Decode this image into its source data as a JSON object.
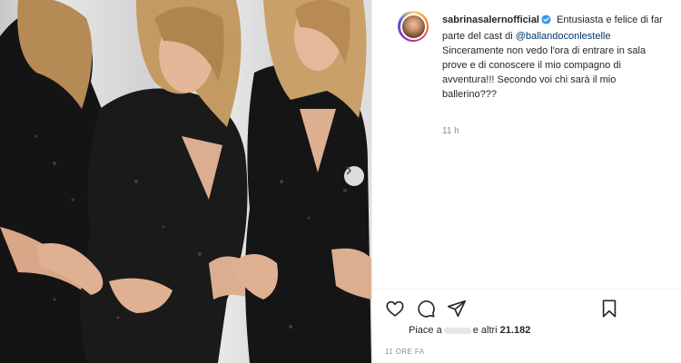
{
  "post": {
    "author": {
      "username": "sabrinasalernofficial",
      "verified": true
    },
    "caption": {
      "text_before_mention": "Entusiasta e felice di far parte del cast di",
      "mention": "@ballandoconlestelle",
      "text_after_mention": "Sinceramente non vedo l'ora di entrare in sala prove e di conoscere il mio compagno di avventura!!! Secondo voi chi sarà il mio ballerino???"
    },
    "comment_time": "11 h",
    "likes": {
      "prefix": "Piace a",
      "middle": "e altri",
      "count": "21.182"
    },
    "timestamp": "11 ORE FA"
  },
  "icons": {
    "media_next": "chevron-right-icon",
    "like": "heart-icon",
    "comment": "comment-icon",
    "share": "send-icon",
    "save": "bookmark-icon",
    "verified": "verified-badge-icon"
  },
  "colors": {
    "verified_badge": "#3897f0",
    "mention": "#00376b",
    "secondary_text": "#8e8e8e"
  }
}
